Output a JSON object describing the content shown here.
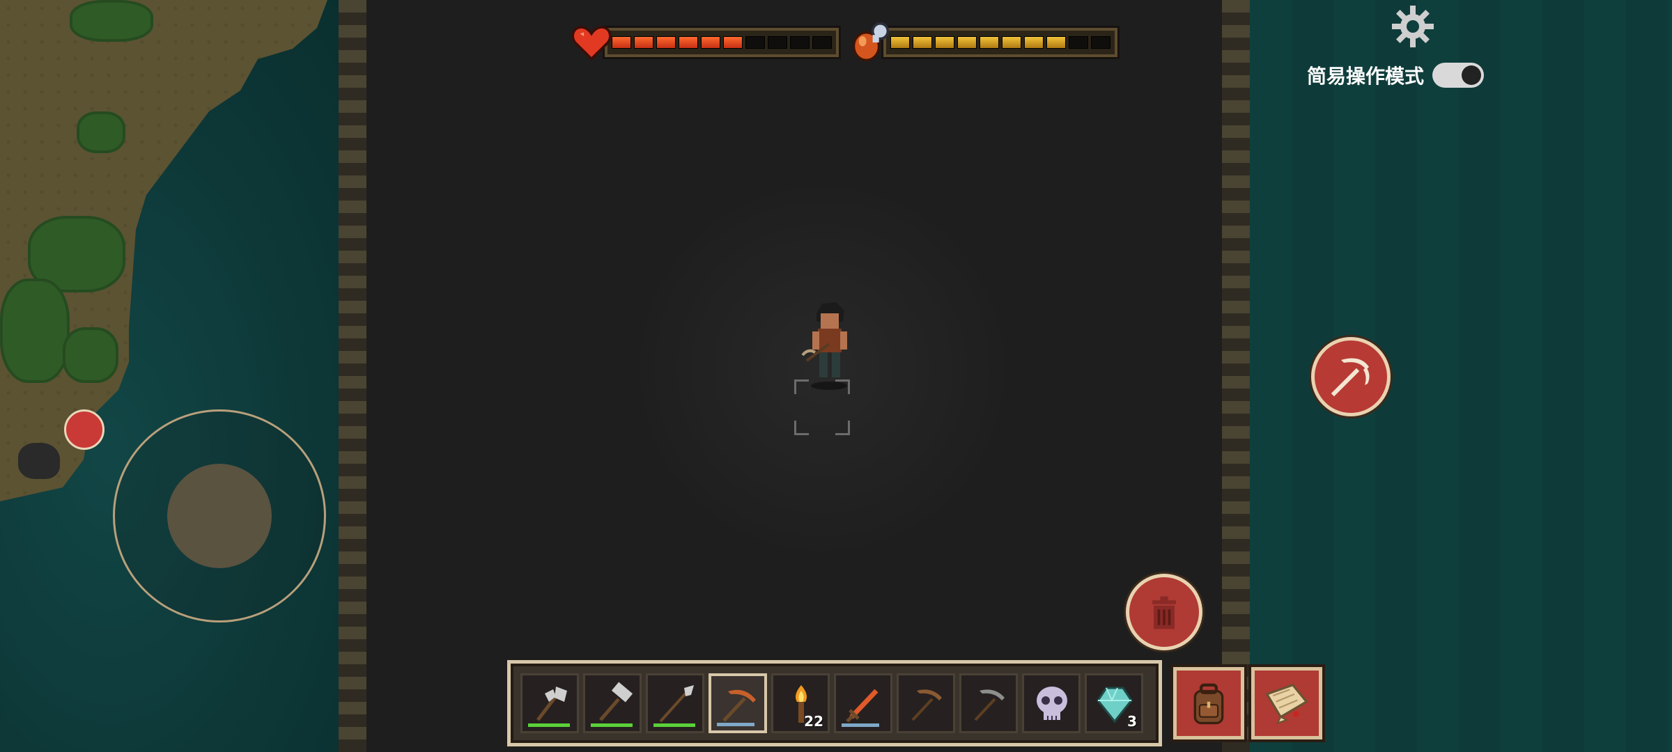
{
  "hud": {
    "health_level": 0.6,
    "hunger_level": 0.8,
    "health_color": "#e23a22",
    "hunger_color": "#e8b020"
  },
  "settings": {
    "icon": "gear-icon",
    "simple_mode_label": "简易操作模式",
    "simple_mode_on": true
  },
  "hotbar": {
    "selected_index": 3,
    "slots": [
      {
        "item": "iron-axe-icon",
        "durability": 1.0,
        "dur_color": "#5bd13a"
      },
      {
        "item": "iron-hammer-icon",
        "durability": 1.0,
        "dur_color": "#5bd13a"
      },
      {
        "item": "iron-spear-icon",
        "durability": 1.0,
        "dur_color": "#5bd13a"
      },
      {
        "item": "copper-pickaxe-icon",
        "durability": 0.9,
        "dur_color": "#7fa8c8"
      },
      {
        "item": "torch-icon",
        "count": "22"
      },
      {
        "item": "copper-sword-icon",
        "durability": 0.9,
        "dur_color": "#7fa8c8"
      },
      {
        "item": "wooden-pickaxe-icon"
      },
      {
        "item": "stone-pickaxe-icon"
      },
      {
        "item": "skull-icon"
      },
      {
        "item": "crystal-gem-icon",
        "count": "3"
      }
    ]
  },
  "buttons": {
    "action": "pickaxe-icon",
    "trash": "trash-icon",
    "inventory": "backpack-icon",
    "map": "map-scroll-icon"
  }
}
